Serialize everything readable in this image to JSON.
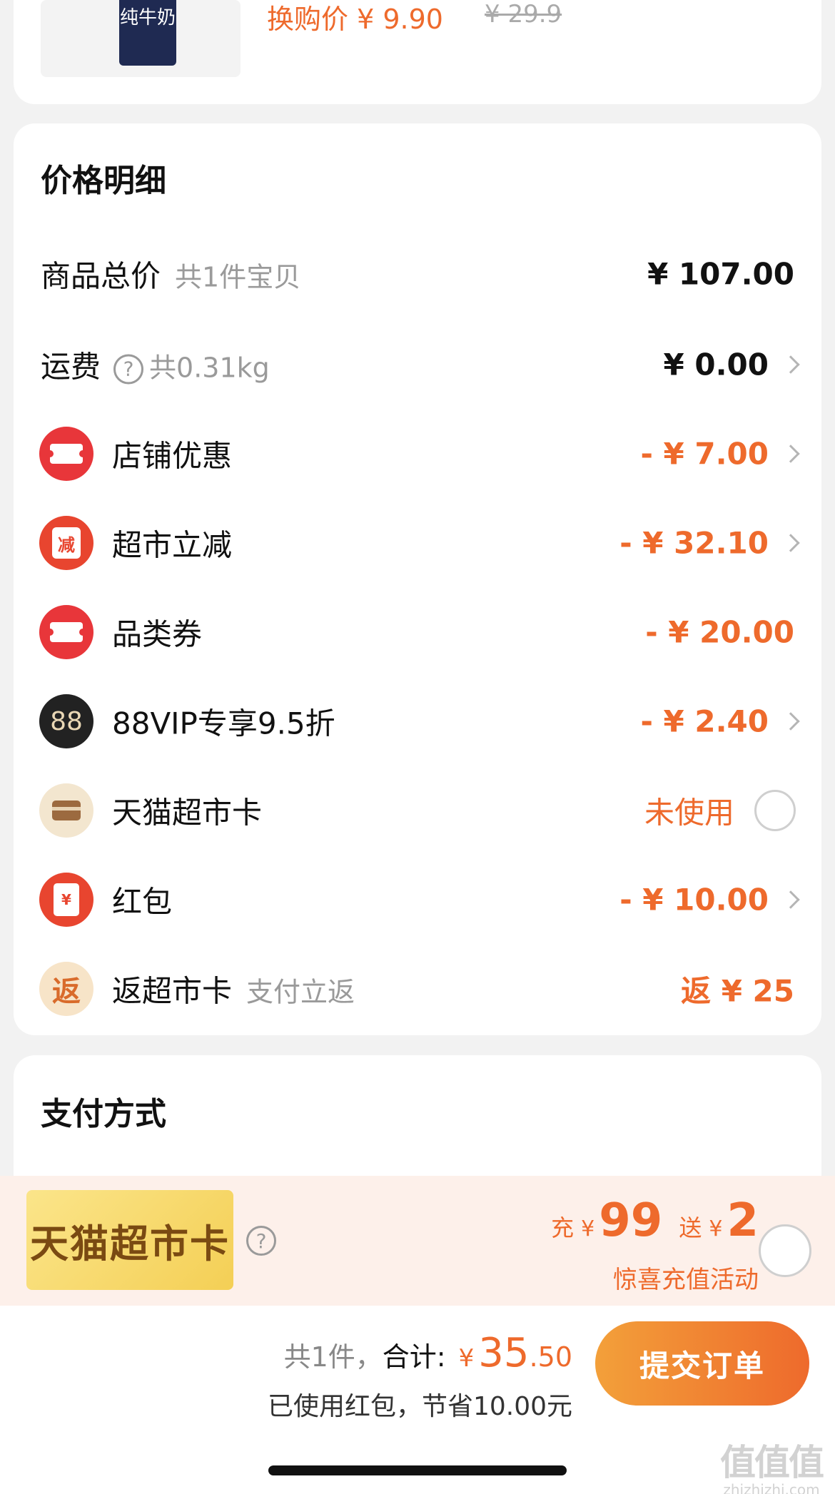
{
  "product": {
    "bottle_label": "纯牛奶",
    "price_text": "换购价 ¥ 9.90",
    "old_price_text": "¥ 29.9"
  },
  "price_detail": {
    "title": "价格明细",
    "rows": [
      {
        "label": "商品总价",
        "sub": "共1件宝贝",
        "value": "¥ 107.00"
      },
      {
        "label": "运费",
        "sub": "共0.31kg",
        "value": "¥ 0.00"
      },
      {
        "label": "店铺优惠",
        "value": "- ¥ 7.00"
      },
      {
        "label": "超市立减",
        "icon_text": "减",
        "value": "- ¥ 32.10"
      },
      {
        "label": "品类券",
        "value": "- ¥ 20.00"
      },
      {
        "label": "88VIP专享9.5折",
        "icon_text": "88",
        "value": "- ¥ 2.40"
      },
      {
        "label": "天猫超市卡",
        "value": "未使用"
      },
      {
        "label": "红包",
        "icon_text": "¥",
        "value": "- ¥ 10.00"
      },
      {
        "label": "返超市卡",
        "sub": "支付立返",
        "icon_text": "返",
        "value": "返 ¥ 25"
      }
    ],
    "help_glyph": "?"
  },
  "payment": {
    "title": "支付方式"
  },
  "promo": {
    "card_text": "天猫超市卡",
    "help_glyph": "?",
    "charge_word": "充",
    "yen": "¥",
    "charge_amount": "99",
    "bonus_word": "送",
    "bonus_amount": "2",
    "subtitle": "惊喜充值活动"
  },
  "checkout": {
    "count_text": "共1件，",
    "total_label": "合计:",
    "yen": "¥",
    "total_int": "35",
    "total_dec": ".50",
    "saving_text": "已使用红包，节省10.00元",
    "submit_label": "提交订单"
  },
  "watermark": {
    "mark": "值值值",
    "site": "zhizhizhi.com"
  },
  "colors": {
    "accent": "#ee6a2c",
    "red_icon": "#e8363a",
    "background": "#f2f2f2"
  }
}
